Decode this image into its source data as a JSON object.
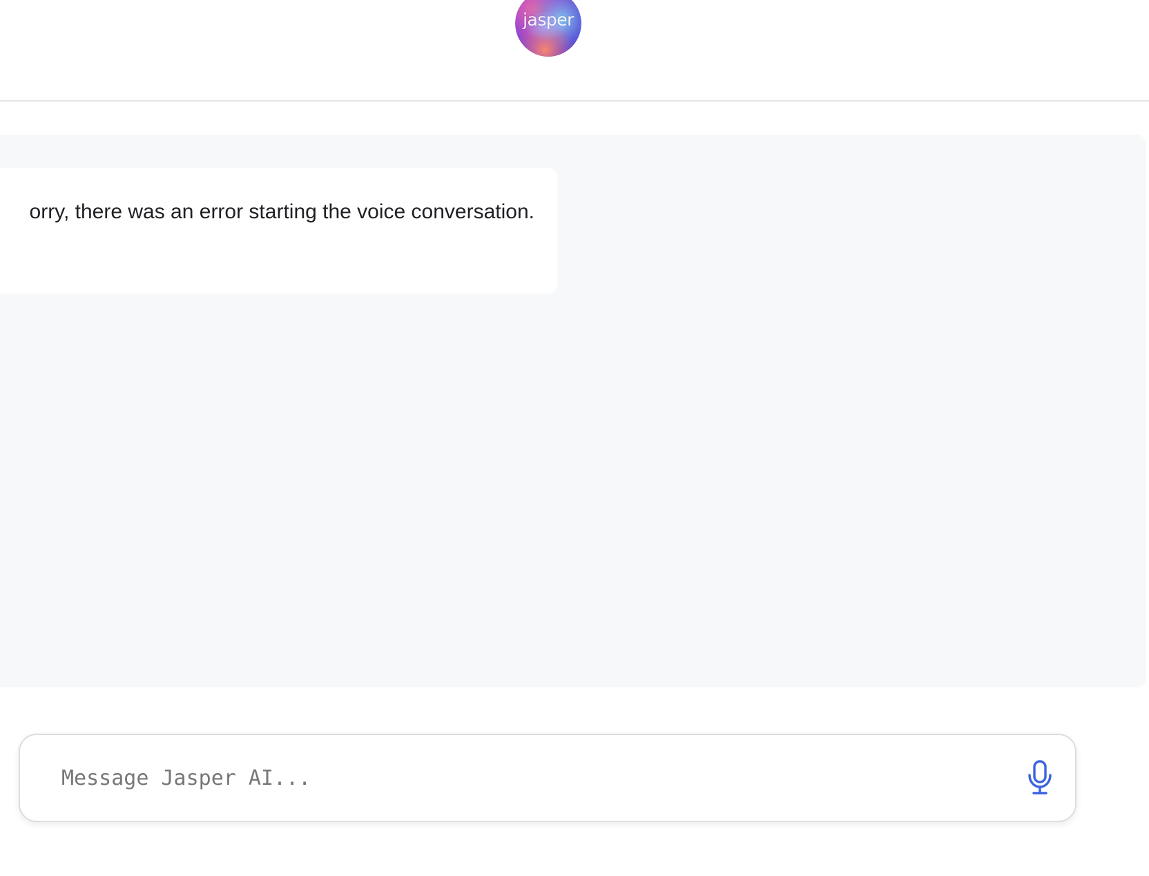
{
  "header": {
    "logo_text": "jasper"
  },
  "conversation": {
    "messages": [
      {
        "text": "orry, there was an error starting the voice conversation."
      }
    ]
  },
  "composer": {
    "placeholder": "Message Jasper AI...",
    "mic_icon": "microphone-icon",
    "accent_color": "#3b63e0"
  },
  "colors": {
    "chat_background": "#f7f8fa",
    "message_background": "#ffffff",
    "divider": "#e3e4e7"
  }
}
